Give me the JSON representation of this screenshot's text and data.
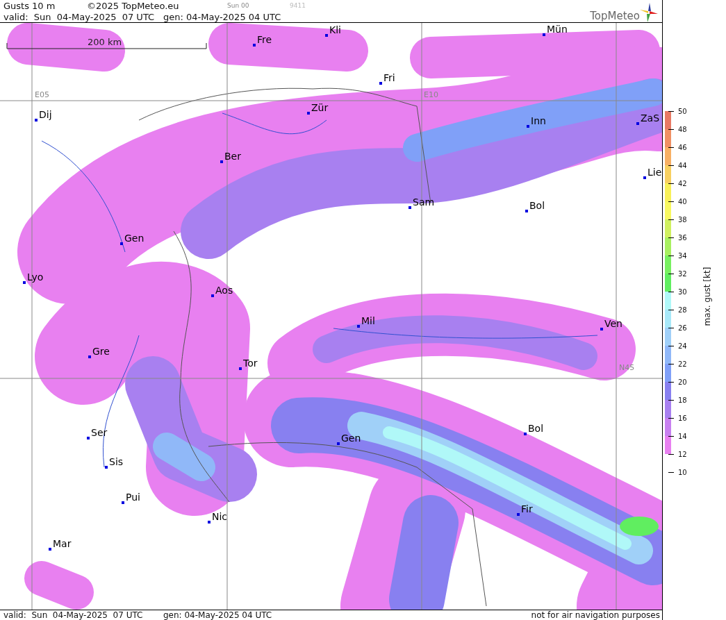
{
  "header": {
    "title": "Gusts 10 m",
    "copyright": "©2025 TopMeteo.eu",
    "run": "Sun 00",
    "code": "9411",
    "valid": "valid:  Sun  04-May-2025  07 UTC",
    "generated": "gen: 04-May-2025 04 UTC",
    "logo": "TopMeteo"
  },
  "map": {
    "scale": "200 km",
    "grid_labels": [
      "E05",
      "E10",
      "N45"
    ],
    "cities": [
      "Kli",
      "Mün",
      "Fre",
      "Fri",
      "Dij",
      "Zür",
      "Inn",
      "ZaS",
      "Ber",
      "Lie",
      "Sam",
      "Bol",
      "Gen",
      "Lyo",
      "Aos",
      "Mil",
      "Ven",
      "Gre",
      "Tor",
      "Ser",
      "Gen",
      "Bol",
      "Sis",
      "Pui",
      "Nic",
      "Fir",
      "Mar"
    ]
  },
  "legend": {
    "title": "max. gust [kt]",
    "ticks": [
      "50",
      "48",
      "46",
      "44",
      "42",
      "40",
      "38",
      "36",
      "34",
      "32",
      "30",
      "28",
      "26",
      "24",
      "22",
      "20",
      "18",
      "16",
      "14",
      "12",
      "10"
    ],
    "bands": [
      {
        "color": "#e87a64"
      },
      {
        "color": "#f09064"
      },
      {
        "color": "#f8b064"
      },
      {
        "color": "#f8d060"
      },
      {
        "color": "#f8f058"
      },
      {
        "color": "#f8f860"
      },
      {
        "color": "#d0f060"
      },
      {
        "color": "#a8f060"
      },
      {
        "color": "#78f060"
      },
      {
        "color": "#60ee60"
      },
      {
        "color": "#b0f8f8"
      },
      {
        "color": "#a8e8f8"
      },
      {
        "color": "#a0d0f8"
      },
      {
        "color": "#90b8f8"
      },
      {
        "color": "#80a0f8"
      },
      {
        "color": "#8880f0"
      },
      {
        "color": "#a880f0"
      },
      {
        "color": "#c880f0"
      },
      {
        "color": "#e880f0"
      }
    ]
  },
  "footer": {
    "valid": "valid:  Sun  04-May-2025  07 UTC",
    "generated": "gen: 04-May-2025 04 UTC",
    "notice": "not for air navigation purposes"
  }
}
